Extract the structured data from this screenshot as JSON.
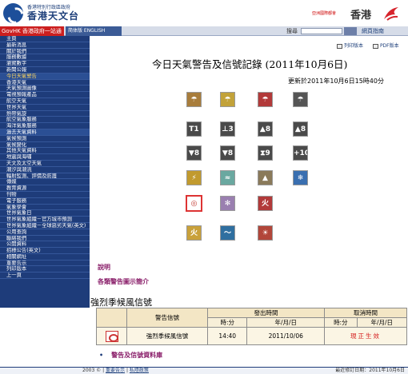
{
  "header": {
    "logo_line1": "香港特別行政區政府",
    "logo_line2": "香港天文台",
    "brand_tag": "亞洲國際都會",
    "brand_word": "香港"
  },
  "topbar": {
    "govhk": "GovHK 香港政府一站通",
    "lang": "简体版 ENGLISH",
    "search_label": "搜尋",
    "search_value": "",
    "go_label": "",
    "advanced_link": "網頁指南"
  },
  "sidebar": {
    "items": [
      "主頁",
      "最新消息",
      "關於我們",
      "服務數據",
      "瀏覽數字",
      "新聞公報",
      "今日天氣警告",
      "香港天氣",
      "天氣預測圖像",
      "電視預報產品",
      "航空天氣",
      "世界天氣",
      "熱帶氣旋",
      "航空氣象服務",
      "海洋氣象服務",
      "過去天氣資料",
      "氣候預測",
      "氣候變化",
      "其他天氣資料",
      "地震與海嘯",
      "天文及太空天氣",
      "潮汐與潮流",
      "輻射監測、評價及防護",
      "傳媒",
      "教育資源",
      "刊物",
      "電子服務",
      "氣象學會",
      "世界氣象日",
      "世界氣象組織－官方城市預測",
      "世界氣象組織－全球惡劣天氣(英文)",
      "公用查詢",
      "聯絡我們",
      "公開資料",
      "招標公告(英文)",
      "相關網址",
      "重要告示",
      "列印版本",
      "上一頁"
    ]
  },
  "main": {
    "print_label": "列印版本",
    "pdf_label": "PDF版本",
    "title": "今日天氣警告及信號記錄 (2011年10月6日)",
    "updated": "更新於2011年10月6日15時40分",
    "shuoming": "說明",
    "graphic_link": "各類警告圖示簡介",
    "section_title": "強烈季候風信號"
  },
  "table": {
    "col_signal": "警告信號",
    "col_issued": "發出時間",
    "col_cancelled": "取消時間",
    "sub_hm": "時:分",
    "sub_ymd": "年/月/日",
    "row": {
      "name": "強烈季候風信號",
      "issue_time": "14:40",
      "issue_date": "2011/10/06",
      "status": "現正生效"
    }
  },
  "links": {
    "records": "警告及信號資料庫"
  },
  "footer": {
    "year": "2003 ©",
    "notice": "重要告示",
    "privacy": "私隱政策",
    "revised": "最近修訂日期：2011年10月6日"
  },
  "colors": {
    "sidebar_bg": "#1e3c7a",
    "govhk_red": "#cc1f1f",
    "link_purple": "#8a1f6a",
    "in_force_red": "#d41c1c",
    "table_header": "#f3e6c5"
  },
  "signals": [
    {
      "name": "amber-rain-icon",
      "color": "#a87d3c",
      "glyph": "☂"
    },
    {
      "name": "yellow-rain-icon",
      "color": "#c2a23a",
      "glyph": "☂"
    },
    {
      "name": "red-rain-icon",
      "color": "#b23a3a",
      "glyph": "☂"
    },
    {
      "name": "black-rain-icon",
      "color": "#555555",
      "glyph": "☂"
    },
    {
      "name": "signal-1-icon",
      "color": "#4a4a4a",
      "glyph": "T1"
    },
    {
      "name": "signal-3-icon",
      "color": "#4a4a4a",
      "glyph": "⊥3"
    },
    {
      "name": "signal-8-ne-icon",
      "color": "#4a4a4a",
      "glyph": "▲8"
    },
    {
      "name": "signal-8-nw-icon",
      "color": "#4a4a4a",
      "glyph": "▲8"
    },
    {
      "name": "signal-8-se-icon",
      "color": "#4a4a4a",
      "glyph": "▼8"
    },
    {
      "name": "signal-8-sw-icon",
      "color": "#4a4a4a",
      "glyph": "▼8"
    },
    {
      "name": "signal-9-icon",
      "color": "#4a4a4a",
      "glyph": "⧗9"
    },
    {
      "name": "signal-10-icon",
      "color": "#4a4a4a",
      "glyph": "+10"
    },
    {
      "name": "thunderstorm-icon",
      "color": "#c19a2e",
      "glyph": "⚡"
    },
    {
      "name": "flooding-icon",
      "color": "#6aa8a0",
      "glyph": "≈"
    },
    {
      "name": "landslip-icon",
      "color": "#8a7a5a",
      "glyph": "▲"
    },
    {
      "name": "cold-icon",
      "color": "#3a6fb0",
      "glyph": "❄"
    },
    {
      "name": "strong-monsoon-icon",
      "color": "#c0342c",
      "glyph": "◎",
      "active": true
    },
    {
      "name": "frost-icon",
      "color": "#9a7fb0",
      "glyph": "✻"
    },
    {
      "name": "fire-red-icon",
      "color": "#b23a3a",
      "glyph": "火"
    },
    {
      "name": "fire-yellow-icon",
      "color": "#c9a13a",
      "glyph": "火"
    },
    {
      "name": "tsunami-icon",
      "color": "#2f6fa0",
      "glyph": "〜"
    },
    {
      "name": "very-hot-icon",
      "color": "#b2463a",
      "glyph": "☀"
    }
  ]
}
